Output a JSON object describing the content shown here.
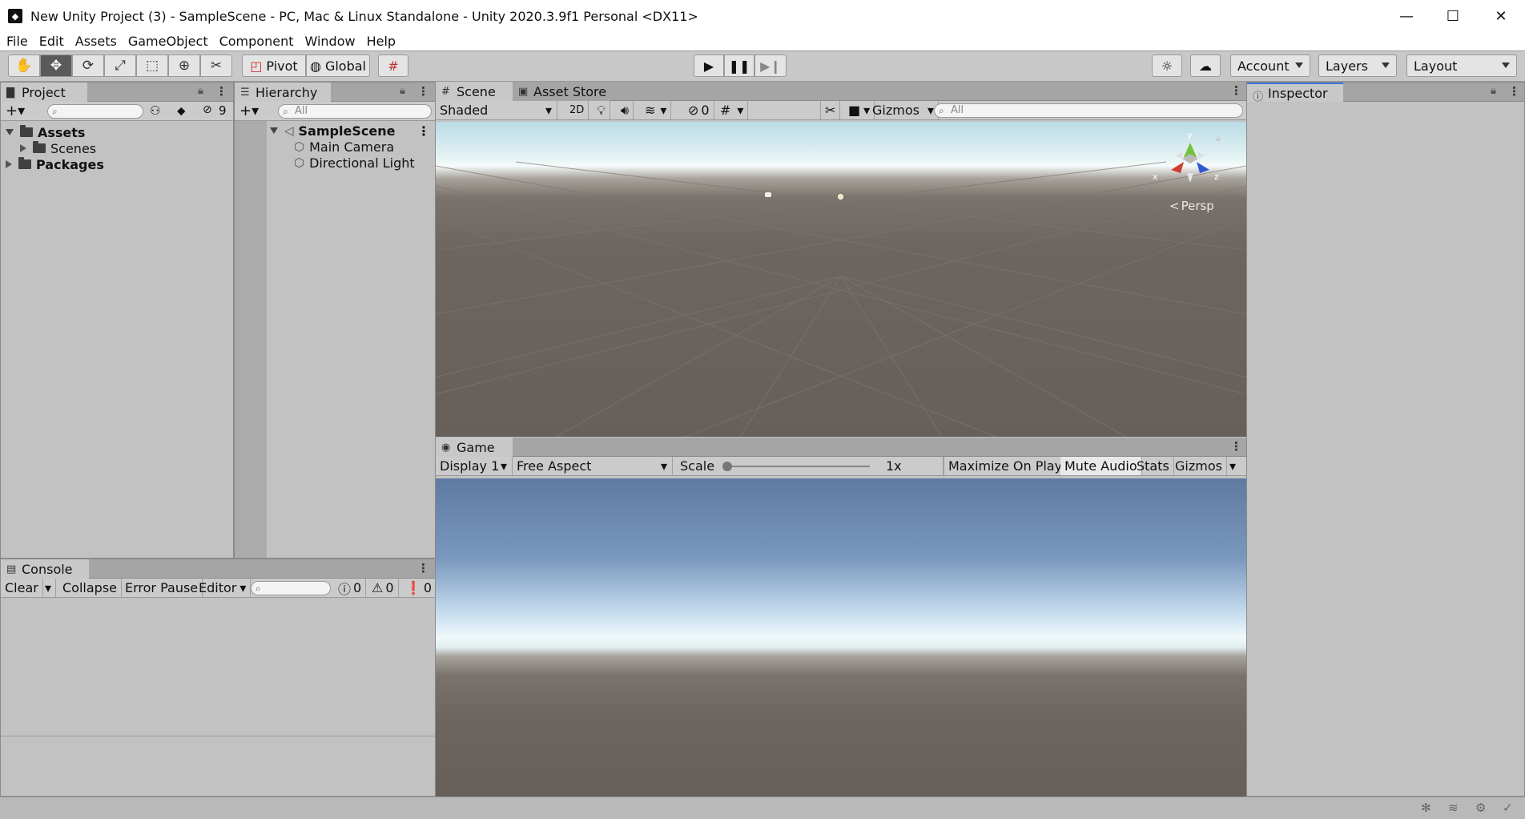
{
  "window": {
    "title": "New Unity Project (3) - SampleScene - PC, Mac & Linux Standalone - Unity 2020.3.9f1 Personal <DX11>",
    "minimize": "—",
    "maximize": "☐",
    "close": "✕"
  },
  "menu": [
    "File",
    "Edit",
    "Assets",
    "GameObject",
    "Component",
    "Window",
    "Help"
  ],
  "toolbar": {
    "pivot_label": "Pivot",
    "global_label": "Global",
    "account_label": "Account",
    "layers_label": "Layers",
    "layout_label": "Layout"
  },
  "project": {
    "tab_label": "Project",
    "hidden_count": "9",
    "tree": [
      {
        "label": "Assets",
        "bold": true
      },
      {
        "label": "Scenes"
      },
      {
        "label": "Packages",
        "bold": true
      }
    ]
  },
  "hierarchy": {
    "tab_label": "Hierarchy",
    "search_placeholder": "All",
    "scene_name": "SampleScene",
    "objects": [
      "Main Camera",
      "Directional Light"
    ]
  },
  "scene": {
    "tab_label": "Scene",
    "asset_store_tab": "Asset Store",
    "shading_mode": "Shaded",
    "mode_2d": "2D",
    "hidden_count": "0",
    "gizmos_label": "Gizmos",
    "search_placeholder": "All",
    "persp_label": "Persp",
    "axis_x": "x",
    "axis_y": "y",
    "axis_z": "z"
  },
  "game": {
    "tab_label": "Game",
    "display": "Display 1",
    "aspect": "Free Aspect",
    "scale_label": "Scale",
    "scale_value": "1x",
    "maximize_label": "Maximize On Play",
    "mute_label": "Mute Audio",
    "stats_label": "Stats",
    "gizmos_label": "Gizmos"
  },
  "console": {
    "tab_label": "Console",
    "clear_label": "Clear",
    "collapse_label": "Collapse",
    "error_pause_label": "Error Pause",
    "editor_label": "Editor",
    "log_count": "0",
    "warn_count": "0",
    "error_count": "0"
  },
  "inspector": {
    "tab_label": "Inspector"
  }
}
